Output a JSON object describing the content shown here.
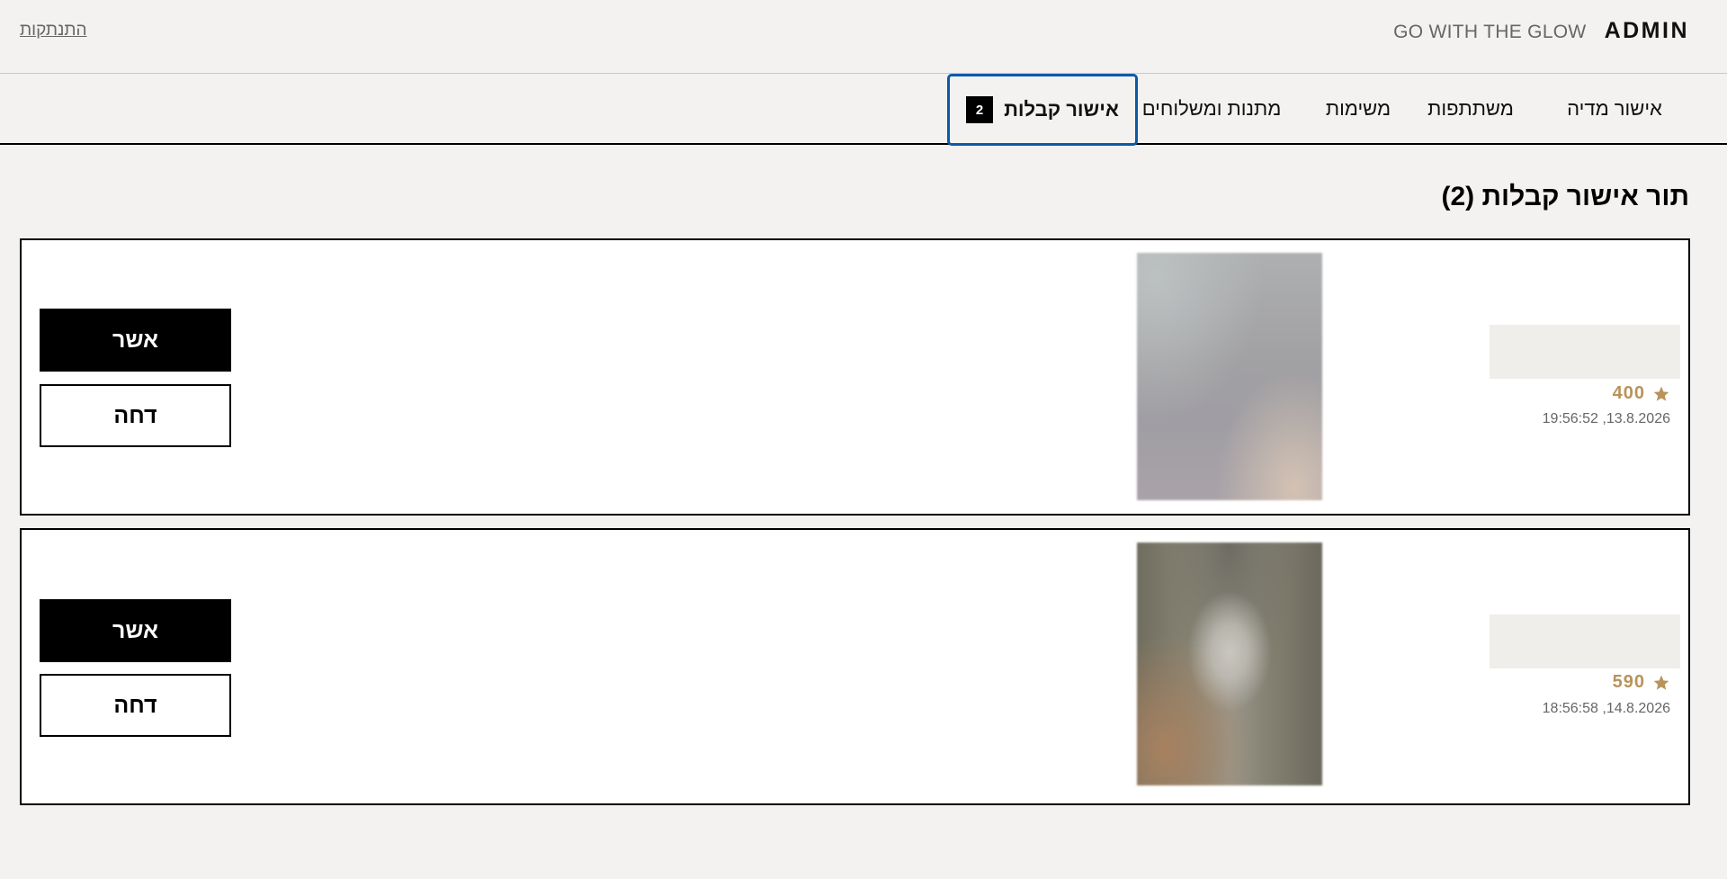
{
  "header": {
    "brand_admin": "ADMIN",
    "brand_tagline": "GO WITH THE GLOW",
    "logout_label": "התנתקות"
  },
  "tabs": [
    {
      "label": "אישור מדיה",
      "active": false
    },
    {
      "label": "משתתפות",
      "active": false
    },
    {
      "label": "משימות",
      "active": false
    },
    {
      "label": "מתנות ומשלוחים",
      "active": false
    },
    {
      "label": "אישור קבלות",
      "active": true,
      "badge": "2"
    }
  ],
  "main": {
    "title": "תור אישור קבלות (2)"
  },
  "receipts": [
    {
      "points": "400",
      "date": "13.8.2026, 19:56:52",
      "approve_label": "אשר",
      "reject_label": "דחה"
    },
    {
      "points": "590",
      "date": "14.8.2026, 18:56:58",
      "approve_label": "אשר",
      "reject_label": "דחה"
    }
  ],
  "colors": {
    "accent_gold": "#b8935a",
    "active_tab_outline": "#0a5aa8",
    "background": "#f3f2f0"
  },
  "icons": {
    "points": "star-icon"
  }
}
